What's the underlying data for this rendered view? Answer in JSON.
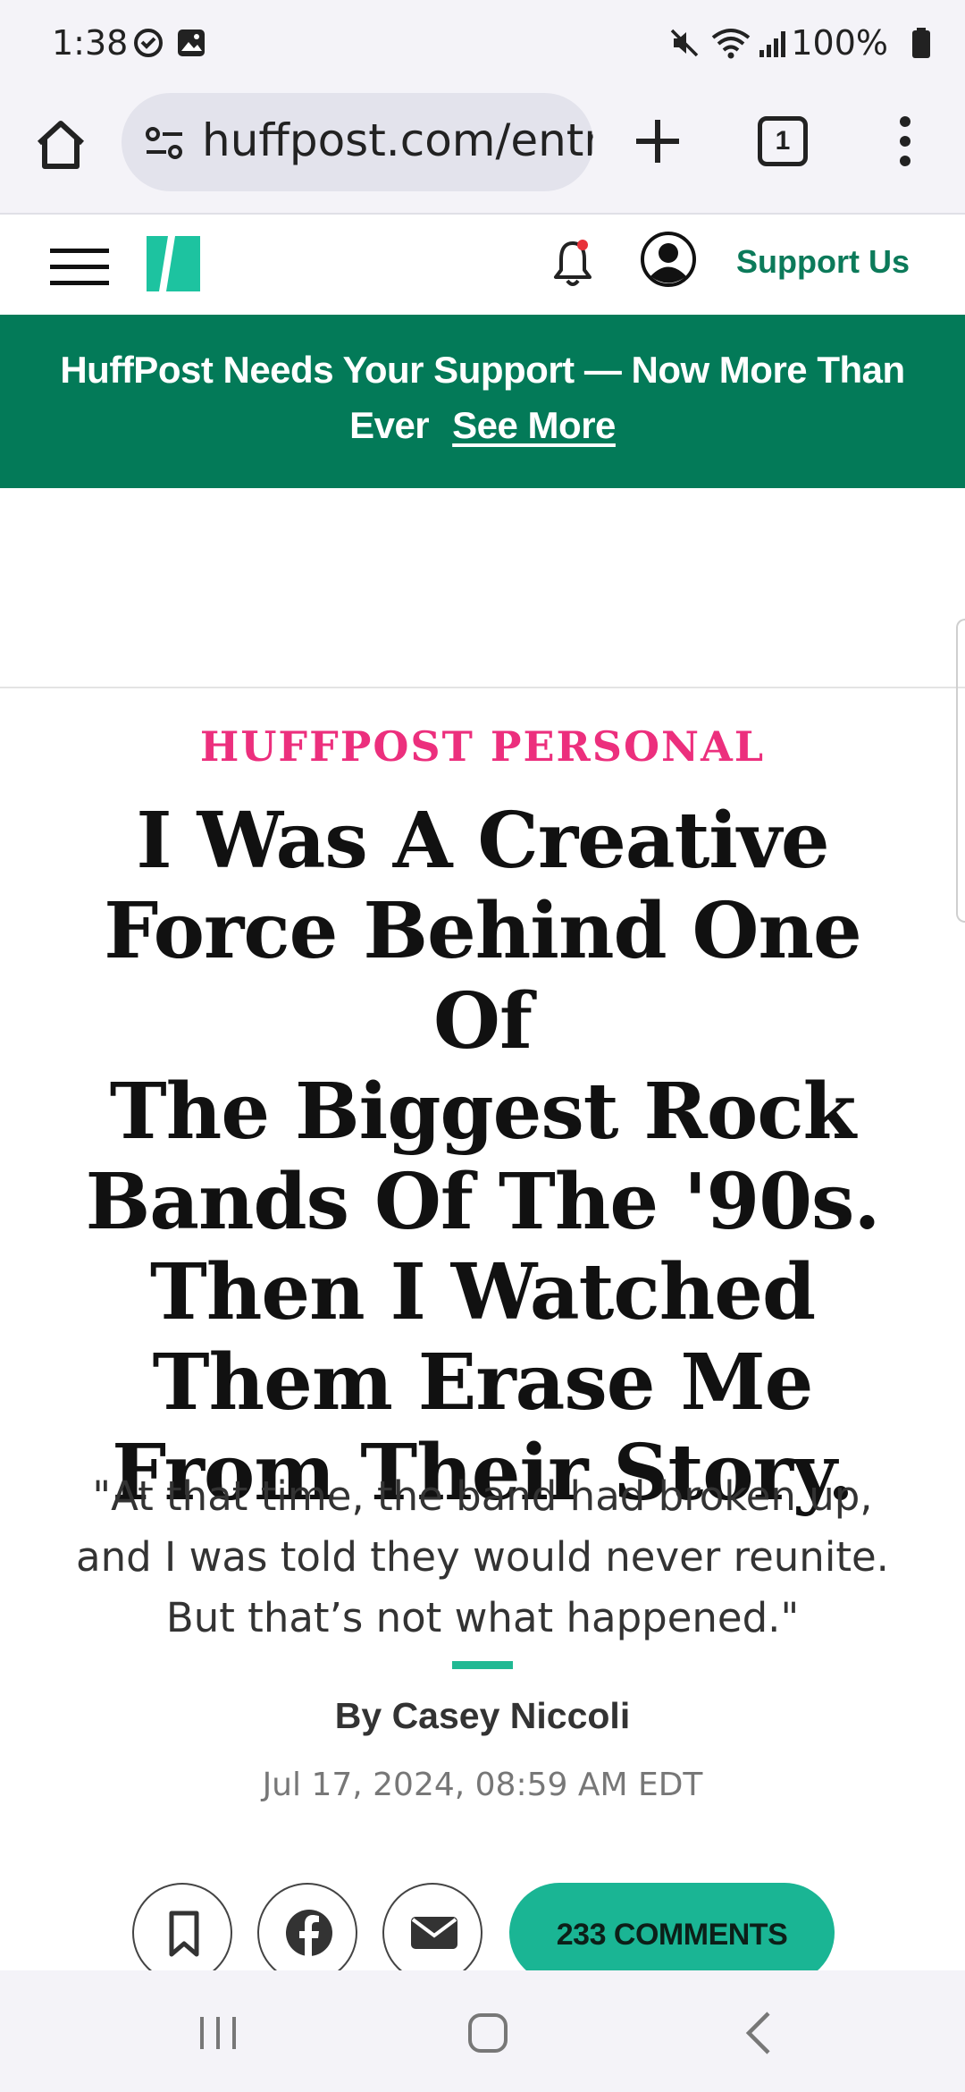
{
  "status_bar": {
    "time": "1:38",
    "battery": "100%"
  },
  "browser": {
    "url": "huffpost.com/entry/",
    "tab_count": "1"
  },
  "site_header": {
    "support_link": "Support Us"
  },
  "banner": {
    "line1": "HuffPost Needs Your Support — Now More Than",
    "line2": "Ever",
    "see_more": "See More"
  },
  "article": {
    "kicker": "HUFFPOST PERSONAL",
    "headline_lines": [
      "I Was A Creative",
      "Force Behind One Of",
      "The Biggest Rock",
      "Bands Of The '90s.",
      "Then I Watched",
      "Them Erase Me",
      "From Their Story."
    ],
    "dek_lines": [
      "\"At that time, the band had broken up,",
      "and I was told they would never reunite.",
      "But that’s not what happened.\""
    ],
    "byline": "By Casey Niccoli",
    "date": "Jul 17, 2024, 08:59 AM EDT"
  },
  "share": {
    "comments_label": "233 COMMENTS"
  },
  "colors": {
    "brand_green": "#037a58",
    "kicker_pink": "#ec2f7d",
    "teal": "#1ab594"
  }
}
